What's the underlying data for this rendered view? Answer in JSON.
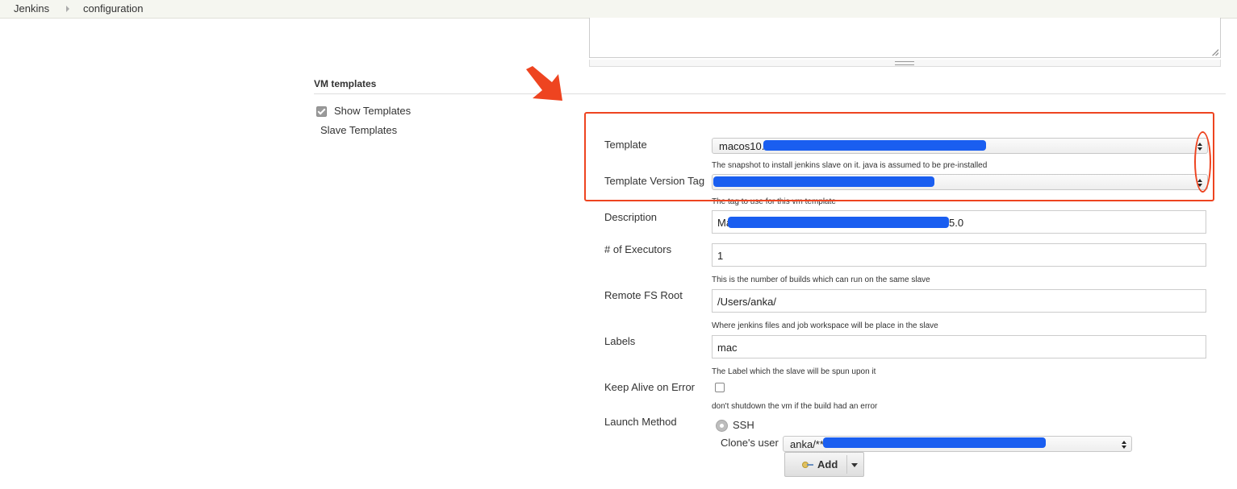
{
  "breadcrumb": {
    "root": "Jenkins",
    "current": "configuration"
  },
  "section": {
    "title": "VM templates"
  },
  "sidebar": {
    "show_templates_label": "Show Templates",
    "slave_templates_label": "Slave Templates"
  },
  "form": {
    "template": {
      "label": "Template",
      "value": "macos10.",
      "help": "The snapshot to install jenkins slave on it. java is assumed to be pre-installed"
    },
    "template_version_tag": {
      "label": "Template Version Tag",
      "value": "",
      "help": "The tag to use for this vm template"
    },
    "description": {
      "label": "Description",
      "value_prefix": "Ma",
      "value_suffix": "5.0"
    },
    "executors": {
      "label": "# of Executors",
      "value": "1",
      "help": "This is the number of builds which can run on the same slave"
    },
    "remote_fs_root": {
      "label": "Remote FS Root",
      "value": "/Users/anka/",
      "help": "Where jenkins files and job workspace will be place in the slave"
    },
    "labels": {
      "label": "Labels",
      "value": "mac",
      "help": "The Label which the slave will be spun upon it"
    },
    "keep_alive": {
      "label": "Keep Alive on Error",
      "help": "don't shutdown the vm if the build had an error"
    },
    "launch_method": {
      "label": "Launch Method",
      "option": "SSH",
      "clone_user_label": "Clone's user",
      "clone_user_value": "anka/**",
      "add_label": "Add"
    }
  },
  "colors": {
    "annotation": "#ee4420",
    "redaction": "#1a5ef0"
  },
  "icons": [
    "chevron-right-icon",
    "checkbox-icon",
    "select-arrows-icon",
    "radio-icon",
    "key-icon",
    "caret-down-icon",
    "arrow-annotation"
  ]
}
